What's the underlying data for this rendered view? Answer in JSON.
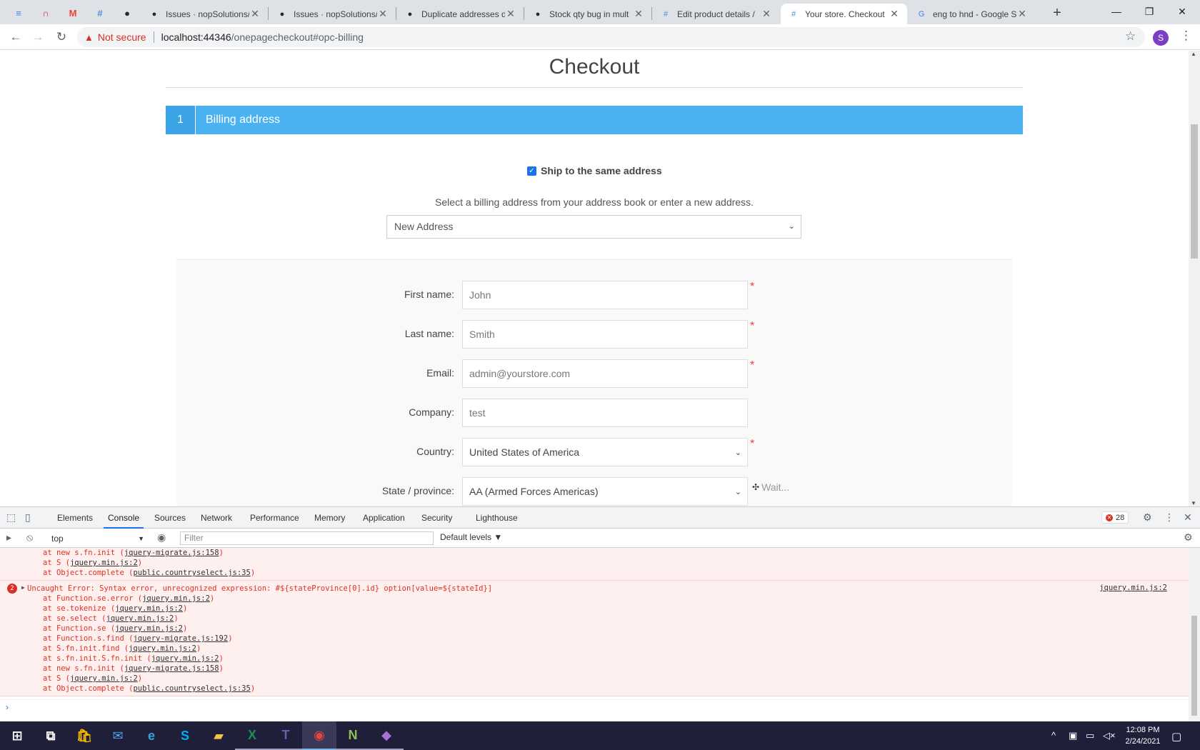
{
  "browser": {
    "pinned_tabs": [
      {
        "icon": "docs-icon",
        "glyph": "≡",
        "color": "#4285f4"
      },
      {
        "icon": "red-arch-icon",
        "glyph": "∩",
        "color": "#d93025"
      },
      {
        "icon": "gmail-icon",
        "glyph": "M",
        "color": "#ea4335"
      },
      {
        "icon": "grid-app-icon",
        "glyph": "#",
        "color": "#4a90d9"
      },
      {
        "icon": "github-icon",
        "glyph": "●",
        "color": "#24292e"
      }
    ],
    "tabs": [
      {
        "title": "Issues · nopSolutions/",
        "icon": "github-icon",
        "glyph": "●",
        "color": "#24292e",
        "active": false
      },
      {
        "title": "Issues · nopSolutions/",
        "icon": "github-icon",
        "glyph": "●",
        "color": "#24292e",
        "active": false
      },
      {
        "title": "Duplicate addresses d",
        "icon": "github-icon",
        "glyph": "●",
        "color": "#24292e",
        "active": false
      },
      {
        "title": "Stock qty bug in mult",
        "icon": "github-icon",
        "glyph": "●",
        "color": "#24292e",
        "active": false
      },
      {
        "title": "Edit product details /",
        "icon": "grid-app-icon",
        "glyph": "#",
        "color": "#4a90d9",
        "active": false
      },
      {
        "title": "Your store. Checkout",
        "icon": "grid-app-icon",
        "glyph": "#",
        "color": "#4a90d9",
        "active": true
      },
      {
        "title": "eng to hnd - Google S",
        "icon": "google-icon",
        "glyph": "G",
        "color": "#4285f4",
        "active": false
      }
    ],
    "not_secure_label": "Not secure",
    "url_host": "localhost:44346",
    "url_path": "/onepagecheckout#opc-billing",
    "profile_initial": "S"
  },
  "page": {
    "title": "Checkout",
    "step": {
      "number": "1",
      "title": "Billing address"
    },
    "ship_same_label": "Ship to the same address",
    "ship_same_checked": true,
    "select_hint": "Select a billing address from your address book or enter a new address.",
    "address_select_value": "New Address",
    "form": [
      {
        "label": "First name:",
        "value": "John",
        "type": "text",
        "required": true
      },
      {
        "label": "Last name:",
        "value": "Smith",
        "type": "text",
        "required": true
      },
      {
        "label": "Email:",
        "value": "admin@yourstore.com",
        "type": "text",
        "required": true
      },
      {
        "label": "Company:",
        "value": "test",
        "type": "text",
        "required": false
      },
      {
        "label": "Country:",
        "value": "United States of America",
        "type": "select",
        "required": true
      },
      {
        "label": "State / province:",
        "value": "AA (Armed Forces Americas)",
        "type": "select",
        "required": false,
        "status": "Wait..."
      }
    ],
    "accent_color": "#4ab2f1",
    "required_color": "#e4434b"
  },
  "devtools": {
    "tabs": [
      "Elements",
      "Console",
      "Sources",
      "Network",
      "Performance",
      "Memory",
      "Application",
      "Security",
      "Lighthouse"
    ],
    "active_tab": "Console",
    "error_count": "28",
    "context": "top",
    "filter_placeholder": "Filter",
    "levels": "Default levels ▼",
    "messages": [
      {
        "count": "",
        "source": "",
        "lines": [
          {
            "text": "at new s.fn.init (",
            "link": "jquery-migrate.js:158",
            "tail": ")"
          },
          {
            "text": "at S (",
            "link": "jquery.min.js:2",
            "tail": ")"
          },
          {
            "text": "at Object.complete (",
            "link": "public.countryselect.js:35",
            "tail": ")"
          }
        ]
      },
      {
        "count": "2",
        "source": "jquery.min.js:2",
        "lines": [
          {
            "text": "Uncaught Error: Syntax error, unrecognized expression: #${stateProvince[0].id} option[value=${stateId}]",
            "link": "",
            "tail": ""
          },
          {
            "text": "    at Function.se.error (",
            "link": "jquery.min.js:2",
            "tail": ")"
          },
          {
            "text": "    at se.tokenize (",
            "link": "jquery.min.js:2",
            "tail": ")"
          },
          {
            "text": "    at se.select (",
            "link": "jquery.min.js:2",
            "tail": ")"
          },
          {
            "text": "    at Function.se (",
            "link": "jquery.min.js:2",
            "tail": ")"
          },
          {
            "text": "    at Function.s.find (",
            "link": "jquery-migrate.js:192",
            "tail": ")"
          },
          {
            "text": "    at S.fn.init.find (",
            "link": "jquery.min.js:2",
            "tail": ")"
          },
          {
            "text": "    at s.fn.init.S.fn.init (",
            "link": "jquery.min.js:2",
            "tail": ")"
          },
          {
            "text": "    at new s.fn.init (",
            "link": "jquery-migrate.js:158",
            "tail": ")"
          },
          {
            "text": "    at S (",
            "link": "jquery.min.js:2",
            "tail": ")"
          },
          {
            "text": "    at Object.complete (",
            "link": "public.countryselect.js:35",
            "tail": ")"
          }
        ]
      }
    ]
  },
  "taskbar": {
    "icons": [
      "windows-start-icon",
      "task-view-icon",
      "store-icon",
      "mail-icon",
      "edge-icon",
      "skype-icon",
      "file-explorer-icon",
      "excel-icon",
      "teams-icon",
      "chrome-icon",
      "notepad-plus-icon",
      "visual-studio-icon"
    ],
    "time": "12:08 PM",
    "date": "2/24/2021"
  }
}
